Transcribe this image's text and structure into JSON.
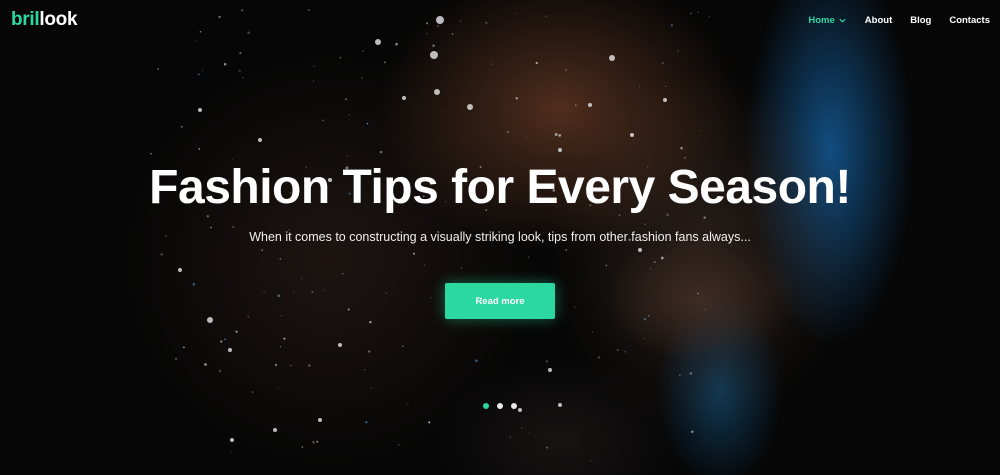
{
  "brand": {
    "part1": "bril",
    "part2": "look",
    "accent_color": "#2bd9a0"
  },
  "nav": {
    "items": [
      {
        "label": "Home",
        "active": true,
        "has_dropdown": true
      },
      {
        "label": "About",
        "active": false
      },
      {
        "label": "Blog",
        "active": false
      },
      {
        "label": "Contacts",
        "active": false
      }
    ]
  },
  "hero": {
    "title": "Fashion Tips for Every Season!",
    "subtitle": "When it comes to constructing a visually striking look, tips from other fashion fans always...",
    "cta_label": "Read more",
    "slides": {
      "count": 3,
      "active_index": 0
    }
  }
}
